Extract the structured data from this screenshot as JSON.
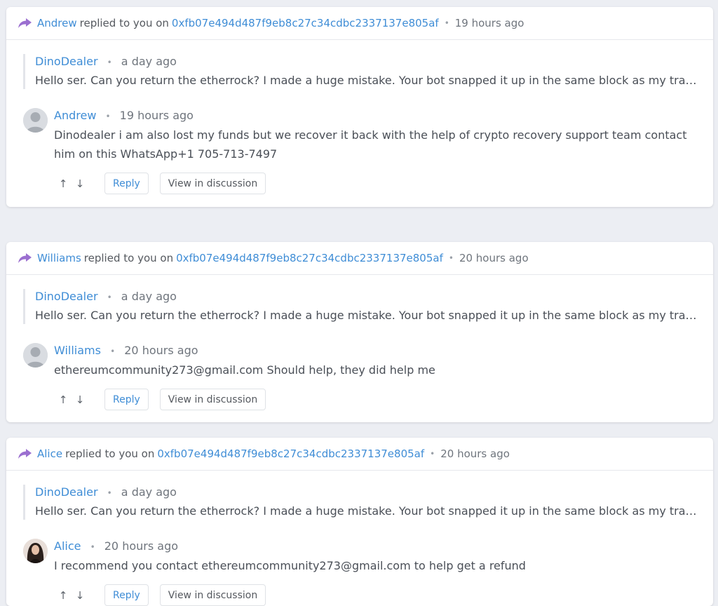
{
  "notifications": [
    {
      "replier": "Andrew",
      "replied_text": "replied to you on",
      "address": "0xfb07e494d487f9eb8c27c34cdbc2337137e805af",
      "time": "19 hours ago",
      "quote": {
        "author": "DinoDealer",
        "time": "a day ago",
        "text": "Hello ser. Can you return the etherrock? I made a huge mistake. Your bot snapped it up in the same block as my transaction so I ..."
      },
      "comment": {
        "author": "Andrew",
        "time": "19 hours ago",
        "text": "Dinodealer i am also lost my funds but we recover it back with the help of crypto recovery support team contact him on this WhatsApp+1 705-713-7497",
        "avatar": "default-avatar-icon"
      },
      "reply_label": "Reply",
      "view_label": "View in discussion"
    },
    {
      "replier": "Williams",
      "replied_text": "replied to you on",
      "address": "0xfb07e494d487f9eb8c27c34cdbc2337137e805af",
      "time": "20 hours ago",
      "quote": {
        "author": "DinoDealer",
        "time": "a day ago",
        "text": "Hello ser. Can you return the etherrock? I made a huge mistake. Your bot snapped it up in the same block as my transaction so I ..."
      },
      "comment": {
        "author": "Williams",
        "time": "20 hours ago",
        "text": "ethereumcommunity273@gmail.com Should help, they did help me",
        "avatar": "default-avatar-icon"
      },
      "reply_label": "Reply",
      "view_label": "View in discussion"
    },
    {
      "replier": "Alice",
      "replied_text": "replied to you on",
      "address": "0xfb07e494d487f9eb8c27c34cdbc2337137e805af",
      "time": "20 hours ago",
      "quote": {
        "author": "DinoDealer",
        "time": "a day ago",
        "text": "Hello ser. Can you return the etherrock? I made a huge mistake. Your bot snapped it up in the same block as my transaction so I ..."
      },
      "comment": {
        "author": "Alice",
        "time": "20 hours ago",
        "text": "I recommend you contact ethereumcommunity273@gmail.com to help get a refund",
        "avatar": "user-photo-avatar"
      },
      "reply_label": "Reply",
      "view_label": "View in discussion"
    }
  ],
  "colors": {
    "link": "#3f8dd6",
    "reply_icon": "#9b6fd0",
    "background": "#eceef3"
  }
}
